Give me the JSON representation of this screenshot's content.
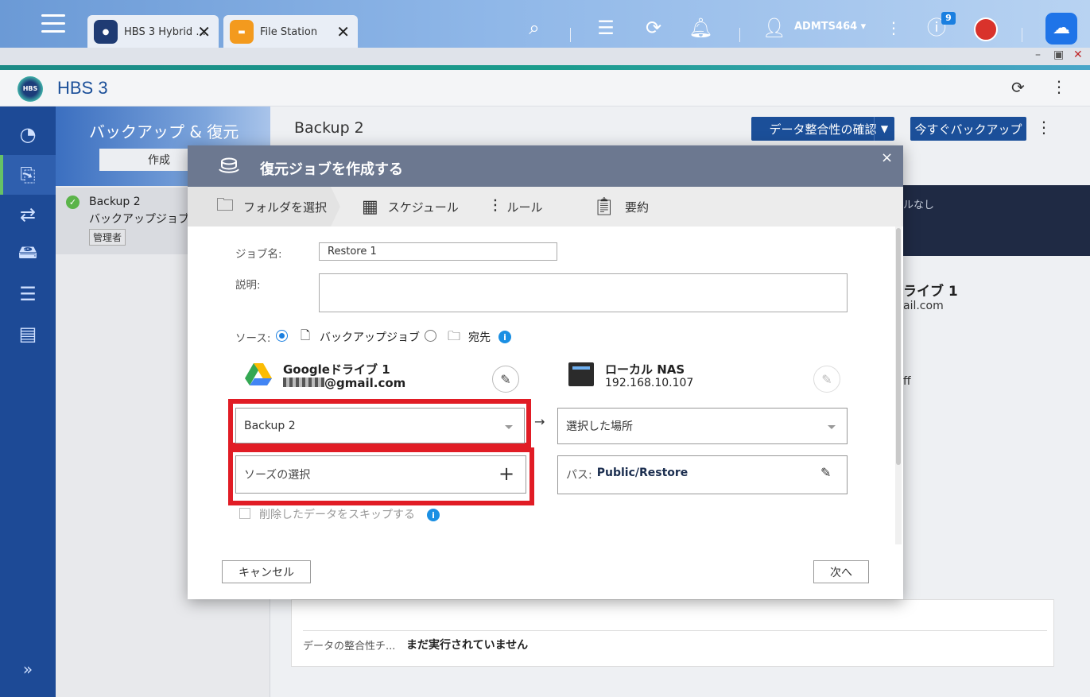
{
  "taskbar": {
    "tabs": [
      {
        "label": "HBS 3 Hybrid ...",
        "icon": "hbs-icon"
      },
      {
        "label": "File Station",
        "icon": "folder-icon"
      }
    ],
    "user": "ADMTS464",
    "notification_count": "9",
    "hbs_badge": "HBS",
    "more_nav": "»"
  },
  "app": {
    "title": "HBS 3"
  },
  "sidebar": {
    "heading": "バックアップ & 復元",
    "create_button": "作成",
    "job": {
      "name": "Backup 2",
      "subtitle": "バックアップジョブ",
      "badge": "管理者"
    }
  },
  "main": {
    "title": "Backup 2",
    "integrity_button": "データ整合性の確認",
    "backup_now_button": "今すぐバックアップ",
    "partial_text_1": "ルなし",
    "partial_text_2": "ライブ 1",
    "partial_text_3": "ail.com",
    "partial_text_4": "ff",
    "integrity_label": "データの整合性チ...",
    "integrity_value": "まだ実行されていません"
  },
  "modal": {
    "title": "復元ジョブを作成する",
    "close": "×",
    "steps": [
      "フォルダを選択",
      "スケジュール",
      "ルール",
      "要約"
    ],
    "job_name_label": "ジョブ名:",
    "job_name_value": "Restore 1",
    "description_label": "説明:",
    "source_label": "ソース:",
    "source_options": [
      "バックアップジョブ",
      "宛先"
    ],
    "source_selected": "バックアップジョブ",
    "source": {
      "name": "Googleドライブ 1",
      "account": "@gmail.com"
    },
    "destination": {
      "name": "ローカル NAS",
      "ip": "192.168.10.107"
    },
    "source_dropdown": "Backup 2",
    "destination_dropdown": "選択した場所",
    "arrow": "→",
    "source_select_placeholder": "ソーズの選択",
    "add_glyph": "+",
    "path_label": "パス:",
    "path_value": "Public/Restore",
    "skip_deleted_label": "削除したデータをスキップする",
    "cancel_button": "キャンセル",
    "next_button": "次へ"
  },
  "colors": {
    "accent_blue": "#1b4f99",
    "highlight_red": "#e11c25",
    "modal_header": "#6c7890",
    "nav_bg": "#1d4a96"
  }
}
